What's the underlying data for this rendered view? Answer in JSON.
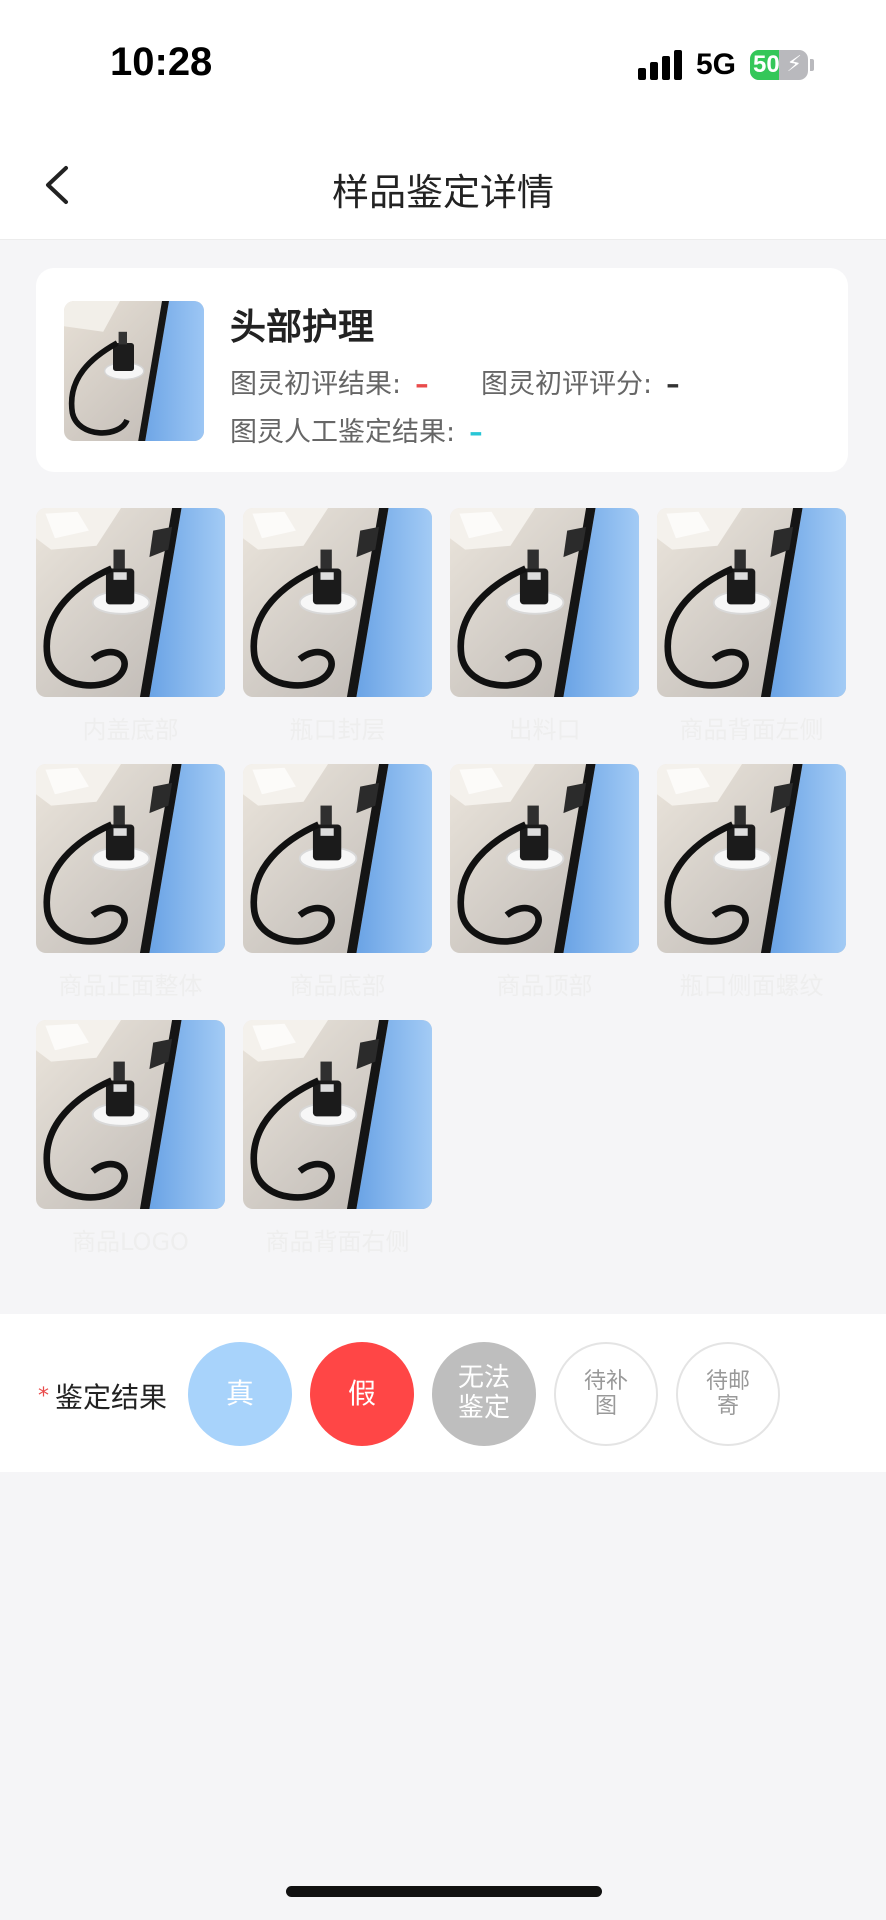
{
  "status_bar": {
    "time": "10:28",
    "network": "5G",
    "battery_level": "50",
    "battery_fraction": 0.5
  },
  "nav": {
    "title": "样品鉴定详情",
    "back_icon": "chevron-left-icon"
  },
  "product": {
    "name": "头部护理",
    "initial_result_label": "图灵初评结果:",
    "initial_result_value": "–",
    "initial_score_label": "图灵初评评分:",
    "initial_score_value": "–",
    "manual_result_label": "图灵人工鉴定结果:",
    "manual_result_value": "–"
  },
  "photos": [
    {
      "caption": "内盖底部"
    },
    {
      "caption": "瓶口封层"
    },
    {
      "caption": "出料口"
    },
    {
      "caption": "商品背面左侧"
    },
    {
      "caption": "商品正面整体"
    },
    {
      "caption": "商品底部"
    },
    {
      "caption": "商品顶部"
    },
    {
      "caption": "瓶口侧面螺纹"
    },
    {
      "caption": "商品LOGO"
    },
    {
      "caption": "商品背面右侧"
    }
  ],
  "result": {
    "label": "鉴定结果",
    "required_mark": "*",
    "options": {
      "true_label": "真",
      "false_label": "假",
      "unable_label": "无法鉴定",
      "await_picture_label": "待补图",
      "await_mail_label": "待邮寄"
    }
  },
  "colors": {
    "accent_red": "#ff4646",
    "true_blue": "#a8d3fb",
    "unable_gray": "#bebebe",
    "battery_green": "#34c759",
    "manual_cyan": "#28c6d6"
  }
}
